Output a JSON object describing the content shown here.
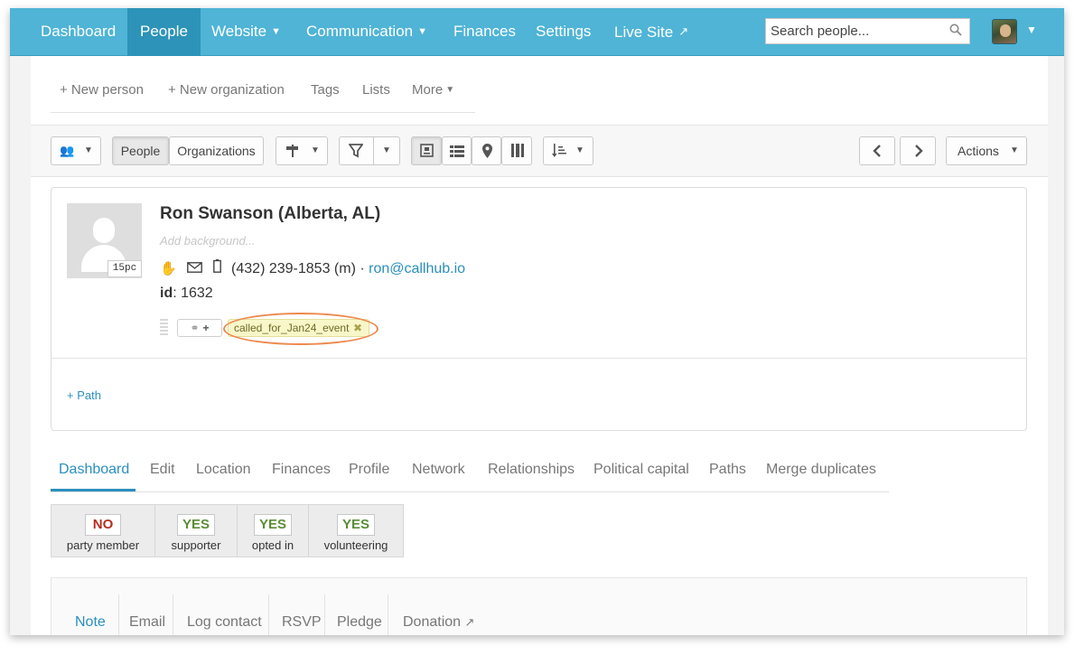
{
  "topnav": {
    "items": [
      {
        "label": "Dashboard"
      },
      {
        "label": "People"
      },
      {
        "label": "Website"
      },
      {
        "label": "Communication"
      },
      {
        "label": "Finances"
      },
      {
        "label": "Settings"
      },
      {
        "label": "Live Site"
      }
    ],
    "search_placeholder": "Search people...",
    "brand_color": "#4fb4d6",
    "active_color": "#2d93b8"
  },
  "subnav": {
    "new_person": "+ New person",
    "new_organization": "+ New organization",
    "tags": "Tags",
    "lists": "Lists",
    "more": "More"
  },
  "toolbar": {
    "people": "People",
    "organizations": "Organizations",
    "actions": "Actions"
  },
  "person": {
    "name": "Ron Swanson (Alberta, AL)",
    "background_placeholder": "Add background...",
    "photo_badge": "15pc",
    "phone": "(432) 239-1853 (m) · ",
    "email": "ron@callhub.io",
    "id_label": "id",
    "id_value": ": 1632",
    "tag": "called_for_Jan24_event",
    "path_link": "+ Path"
  },
  "profile_tabs": [
    "Dashboard",
    "Edit",
    "Location",
    "Finances",
    "Profile",
    "Network",
    "Relationships",
    "Political capital",
    "Paths",
    "Merge duplicates"
  ],
  "flags": [
    {
      "value": "NO",
      "label": "party member"
    },
    {
      "value": "YES",
      "label": "supporter"
    },
    {
      "value": "YES",
      "label": "opted in"
    },
    {
      "value": "YES",
      "label": "volunteering"
    }
  ],
  "action_tabs": [
    "Note",
    "Email",
    "Log contact",
    "RSVP",
    "Pledge",
    "Donation"
  ],
  "icons": {
    "search": "search-icon",
    "external": "external-link-icon",
    "hand": "hand-icon",
    "envelope": "envelope-icon",
    "mobile": "mobile-phone-icon",
    "tag": "tag-icon"
  }
}
